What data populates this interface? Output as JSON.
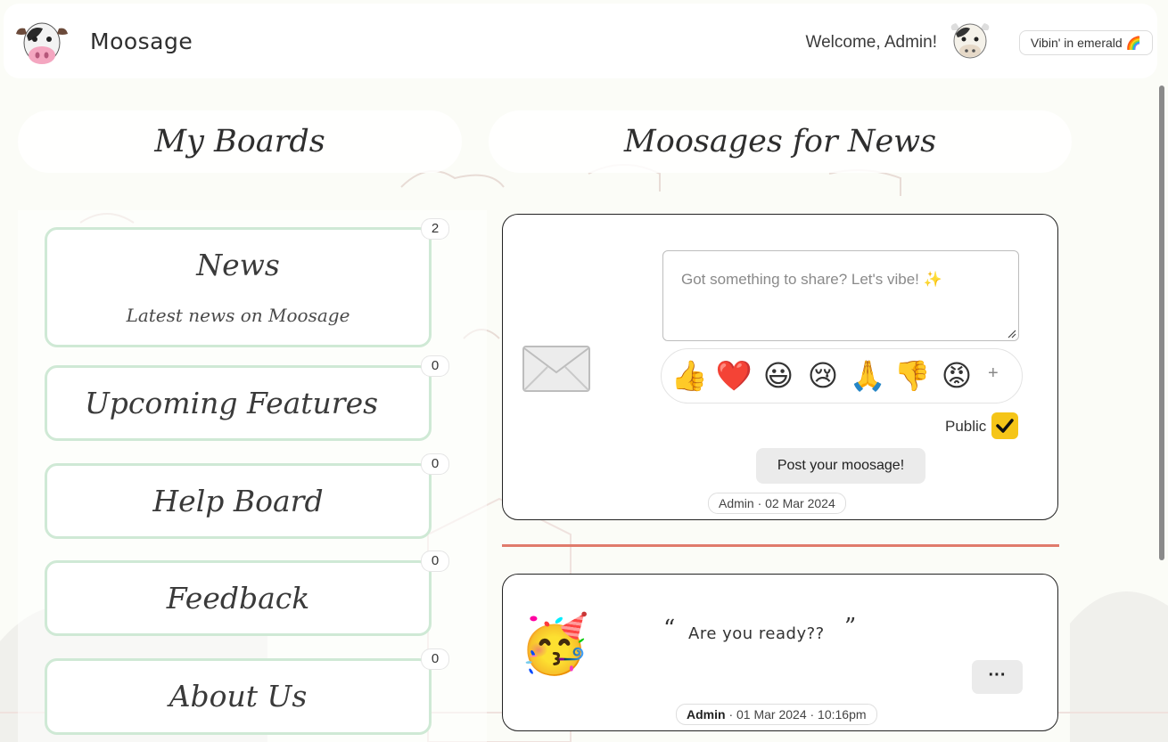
{
  "header": {
    "brand": "Moosage",
    "welcome": "Welcome, Admin!",
    "theme_button": "Vibin' in emerald 🌈",
    "logo_icon": "cow-face-icon",
    "avatar_icon": "cow-avatar-icon"
  },
  "sections": {
    "boards_title": "My Boards",
    "moosages_title": "Moosages for News"
  },
  "boards": [
    {
      "title": "News",
      "subtitle": "Latest news on Moosage",
      "count": "2"
    },
    {
      "title": "Upcoming Features",
      "count": "0"
    },
    {
      "title": "Help Board",
      "count": "0"
    },
    {
      "title": "Feedback",
      "count": "0"
    },
    {
      "title": "About Us",
      "count": "0"
    }
  ],
  "composer": {
    "placeholder": "Got something to share? Let's vibe! ✨",
    "emojis": [
      "👍",
      "❤️",
      "😃",
      "😢",
      "🙏",
      "👎",
      "😡"
    ],
    "add_emoji": "+",
    "public_label": "Public",
    "public_checked": true,
    "post_button": "Post your moosage!",
    "meta": "Admin · 02 Mar 2024",
    "icon": "envelope-icon"
  },
  "messages": [
    {
      "emoji": "🥳",
      "quote_open": "“",
      "text": "Are you ready??",
      "quote_close": "”",
      "more_button": "···",
      "author": "Admin",
      "meta_rest": " · 01 Mar 2024 · 10:16pm"
    }
  ],
  "colors": {
    "accent_check": "#f5c518",
    "board_border": "#cfe9d5",
    "divider": "#e07b6c"
  }
}
